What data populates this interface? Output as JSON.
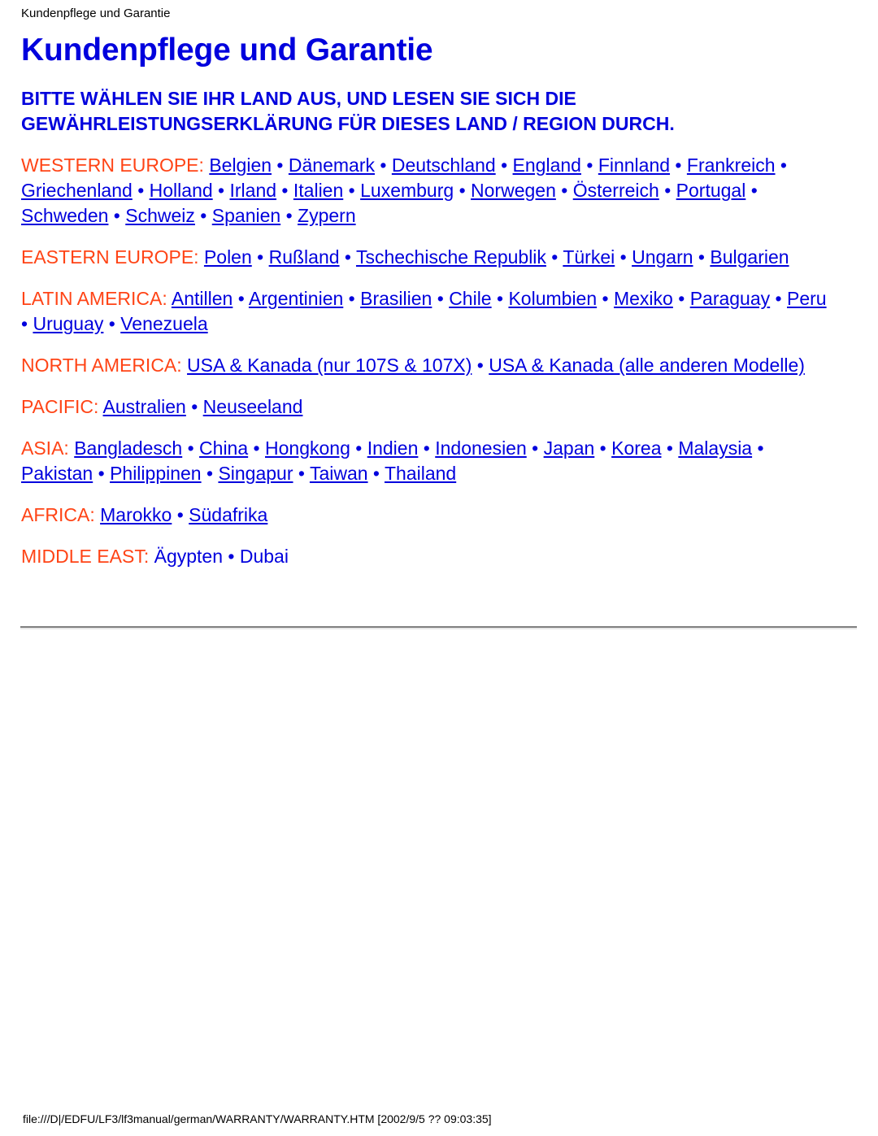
{
  "running_head": "Kundenpflege und Garantie",
  "title": "Kundenpflege und Garantie",
  "intro": "BITTE WÄHLEN SIE IHR LAND AUS, UND LESEN SIE SICH DIE GEWÄHRLEISTUNGSERKLÄRUNG FÜR DIESES LAND / REGION DURCH.",
  "separator": " • ",
  "colors": {
    "region_label": "#FF4416",
    "link": "#0000DD",
    "title": "#0000DD",
    "text": "#000000"
  },
  "regions": [
    {
      "label": "WESTERN EUROPE:",
      "underlined": true,
      "countries": [
        "Belgien",
        "Dänemark",
        "Deutschland",
        "England",
        "Finnland",
        "Frankreich",
        "Griechenland",
        "Holland",
        "Irland",
        "Italien",
        "Luxemburg",
        "Norwegen",
        "Österreich",
        "Portugal",
        "Schweden",
        "Schweiz",
        "Spanien",
        "Zypern"
      ]
    },
    {
      "label": "EASTERN EUROPE:",
      "underlined": true,
      "countries": [
        "Polen",
        "Rußland",
        "Tschechische Republik",
        "Türkei",
        "Ungarn",
        "Bulgarien"
      ]
    },
    {
      "label": "LATIN AMERICA:",
      "underlined": true,
      "countries": [
        "Antillen",
        "Argentinien",
        "Brasilien",
        "Chile",
        "Kolumbien",
        "Mexiko",
        "Paraguay",
        "Peru",
        "Uruguay",
        "Venezuela"
      ]
    },
    {
      "label": "NORTH AMERICA:",
      "underlined": true,
      "countries": [
        "USA & Kanada (nur 107S & 107X)",
        "USA & Kanada (alle anderen Modelle)"
      ]
    },
    {
      "label": "PACIFIC:",
      "underlined": true,
      "countries": [
        "Australien",
        "Neuseeland"
      ]
    },
    {
      "label": "ASIA:",
      "underlined": true,
      "countries": [
        "Bangladesch",
        "China",
        "Hongkong",
        "Indien",
        "Indonesien",
        "Japan",
        "Korea",
        "Malaysia",
        "Pakistan",
        "Philippinen",
        "Singapur",
        "Taiwan",
        "Thailand"
      ]
    },
    {
      "label": "AFRICA:",
      "underlined": true,
      "countries": [
        "Marokko",
        "Südafrika"
      ]
    },
    {
      "label": "MIDDLE EAST:",
      "underlined": false,
      "countries": [
        "Ägypten",
        "Dubai"
      ]
    }
  ],
  "footer": "file:///D|/EDFU/LF3/lf3manual/german/WARRANTY/WARRANTY.HTM [2002/9/5 ?? 09:03:35]"
}
